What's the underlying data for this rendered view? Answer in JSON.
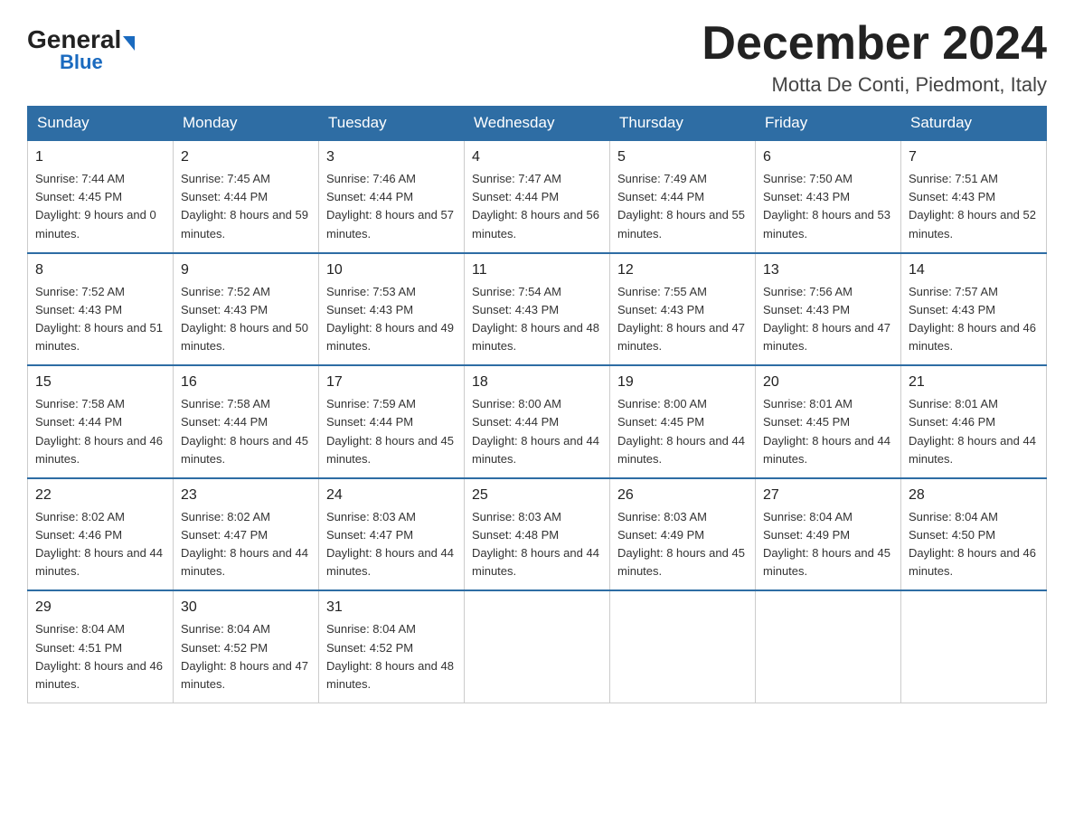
{
  "logo": {
    "general": "General",
    "triangle": "",
    "blue": "Blue"
  },
  "title": "December 2024",
  "subtitle": "Motta De Conti, Piedmont, Italy",
  "days_of_week": [
    "Sunday",
    "Monday",
    "Tuesday",
    "Wednesday",
    "Thursday",
    "Friday",
    "Saturday"
  ],
  "weeks": [
    [
      {
        "day": "1",
        "sunrise": "7:44 AM",
        "sunset": "4:45 PM",
        "daylight": "9 hours and 0 minutes."
      },
      {
        "day": "2",
        "sunrise": "7:45 AM",
        "sunset": "4:44 PM",
        "daylight": "8 hours and 59 minutes."
      },
      {
        "day": "3",
        "sunrise": "7:46 AM",
        "sunset": "4:44 PM",
        "daylight": "8 hours and 57 minutes."
      },
      {
        "day": "4",
        "sunrise": "7:47 AM",
        "sunset": "4:44 PM",
        "daylight": "8 hours and 56 minutes."
      },
      {
        "day": "5",
        "sunrise": "7:49 AM",
        "sunset": "4:44 PM",
        "daylight": "8 hours and 55 minutes."
      },
      {
        "day": "6",
        "sunrise": "7:50 AM",
        "sunset": "4:43 PM",
        "daylight": "8 hours and 53 minutes."
      },
      {
        "day": "7",
        "sunrise": "7:51 AM",
        "sunset": "4:43 PM",
        "daylight": "8 hours and 52 minutes."
      }
    ],
    [
      {
        "day": "8",
        "sunrise": "7:52 AM",
        "sunset": "4:43 PM",
        "daylight": "8 hours and 51 minutes."
      },
      {
        "day": "9",
        "sunrise": "7:52 AM",
        "sunset": "4:43 PM",
        "daylight": "8 hours and 50 minutes."
      },
      {
        "day": "10",
        "sunrise": "7:53 AM",
        "sunset": "4:43 PM",
        "daylight": "8 hours and 49 minutes."
      },
      {
        "day": "11",
        "sunrise": "7:54 AM",
        "sunset": "4:43 PM",
        "daylight": "8 hours and 48 minutes."
      },
      {
        "day": "12",
        "sunrise": "7:55 AM",
        "sunset": "4:43 PM",
        "daylight": "8 hours and 47 minutes."
      },
      {
        "day": "13",
        "sunrise": "7:56 AM",
        "sunset": "4:43 PM",
        "daylight": "8 hours and 47 minutes."
      },
      {
        "day": "14",
        "sunrise": "7:57 AM",
        "sunset": "4:43 PM",
        "daylight": "8 hours and 46 minutes."
      }
    ],
    [
      {
        "day": "15",
        "sunrise": "7:58 AM",
        "sunset": "4:44 PM",
        "daylight": "8 hours and 46 minutes."
      },
      {
        "day": "16",
        "sunrise": "7:58 AM",
        "sunset": "4:44 PM",
        "daylight": "8 hours and 45 minutes."
      },
      {
        "day": "17",
        "sunrise": "7:59 AM",
        "sunset": "4:44 PM",
        "daylight": "8 hours and 45 minutes."
      },
      {
        "day": "18",
        "sunrise": "8:00 AM",
        "sunset": "4:44 PM",
        "daylight": "8 hours and 44 minutes."
      },
      {
        "day": "19",
        "sunrise": "8:00 AM",
        "sunset": "4:45 PM",
        "daylight": "8 hours and 44 minutes."
      },
      {
        "day": "20",
        "sunrise": "8:01 AM",
        "sunset": "4:45 PM",
        "daylight": "8 hours and 44 minutes."
      },
      {
        "day": "21",
        "sunrise": "8:01 AM",
        "sunset": "4:46 PM",
        "daylight": "8 hours and 44 minutes."
      }
    ],
    [
      {
        "day": "22",
        "sunrise": "8:02 AM",
        "sunset": "4:46 PM",
        "daylight": "8 hours and 44 minutes."
      },
      {
        "day": "23",
        "sunrise": "8:02 AM",
        "sunset": "4:47 PM",
        "daylight": "8 hours and 44 minutes."
      },
      {
        "day": "24",
        "sunrise": "8:03 AM",
        "sunset": "4:47 PM",
        "daylight": "8 hours and 44 minutes."
      },
      {
        "day": "25",
        "sunrise": "8:03 AM",
        "sunset": "4:48 PM",
        "daylight": "8 hours and 44 minutes."
      },
      {
        "day": "26",
        "sunrise": "8:03 AM",
        "sunset": "4:49 PM",
        "daylight": "8 hours and 45 minutes."
      },
      {
        "day": "27",
        "sunrise": "8:04 AM",
        "sunset": "4:49 PM",
        "daylight": "8 hours and 45 minutes."
      },
      {
        "day": "28",
        "sunrise": "8:04 AM",
        "sunset": "4:50 PM",
        "daylight": "8 hours and 46 minutes."
      }
    ],
    [
      {
        "day": "29",
        "sunrise": "8:04 AM",
        "sunset": "4:51 PM",
        "daylight": "8 hours and 46 minutes."
      },
      {
        "day": "30",
        "sunrise": "8:04 AM",
        "sunset": "4:52 PM",
        "daylight": "8 hours and 47 minutes."
      },
      {
        "day": "31",
        "sunrise": "8:04 AM",
        "sunset": "4:52 PM",
        "daylight": "8 hours and 48 minutes."
      },
      null,
      null,
      null,
      null
    ]
  ]
}
